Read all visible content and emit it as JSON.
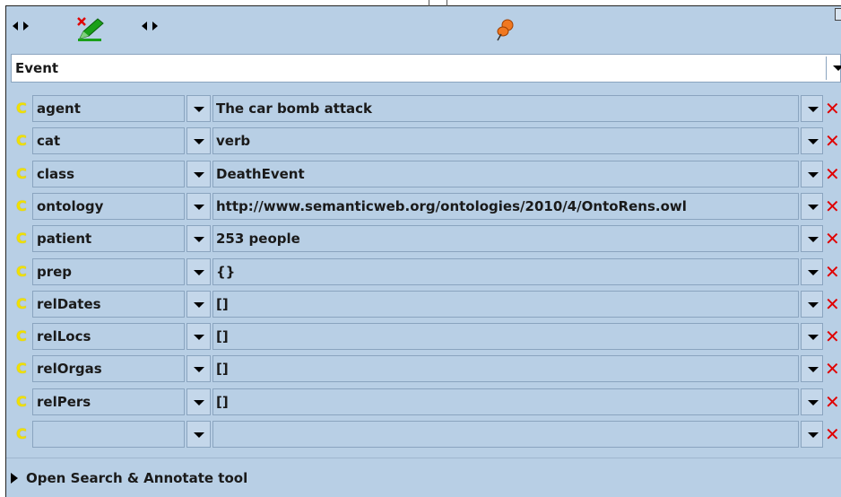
{
  "toolbar": {
    "nav_left_icon": "left-right-arrows-icon",
    "edit_icon": "green-pen-with-red-x-icon",
    "nav_right_icon": "left-right-arrows-icon",
    "pin_icon": "orange-pushpin-icon",
    "corner_icon": "window-corner-icon"
  },
  "type_select": {
    "value": "Event"
  },
  "features": [
    {
      "key": "agent",
      "value": "The car bomb attack"
    },
    {
      "key": "cat",
      "value": "verb"
    },
    {
      "key": "class",
      "value": "DeathEvent"
    },
    {
      "key": "ontology",
      "value": "http://www.semanticweb.org/ontologies/2010/4/OntoRens.owl"
    },
    {
      "key": "patient",
      "value": "253 people"
    },
    {
      "key": "prep",
      "value": "{}"
    },
    {
      "key": "relDates",
      "value": "[]"
    },
    {
      "key": "relLocs",
      "value": "[]"
    },
    {
      "key": "relOrgas",
      "value": "[]"
    },
    {
      "key": "relPers",
      "value": "[]"
    },
    {
      "key": "",
      "value": ""
    }
  ],
  "row_icon_glyph": "C",
  "delete_glyph": "✕",
  "footer": {
    "label": "Open Search & Annotate tool"
  },
  "colors": {
    "background": "#b8cfe5",
    "delete": "#e00000",
    "row_icon": "#f0e000"
  }
}
